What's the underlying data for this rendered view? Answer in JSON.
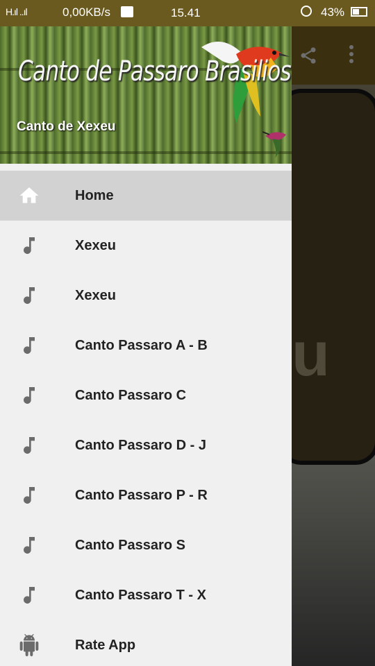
{
  "status_bar": {
    "signal": "H.ıl ..ıl",
    "speed": "0,00KB/s",
    "time": "15.41",
    "battery": "43%"
  },
  "drawer": {
    "app_title": "Canto de Passaro Brasilios",
    "subtitle": "Canto de Xexeu",
    "items": [
      {
        "label": "Home",
        "icon": "home-icon",
        "active": true
      },
      {
        "label": "Xexeu",
        "icon": "music-note-icon"
      },
      {
        "label": "Xexeu",
        "icon": "music-note-icon"
      },
      {
        "label": "Canto Passaro A - B",
        "icon": "music-note-icon"
      },
      {
        "label": "Canto Passaro C",
        "icon": "music-note-icon"
      },
      {
        "label": "Canto Passaro D - J",
        "icon": "music-note-icon"
      },
      {
        "label": "Canto Passaro P - R",
        "icon": "music-note-icon"
      },
      {
        "label": "Canto Passaro S",
        "icon": "music-note-icon"
      },
      {
        "label": "Canto Passaro T - X",
        "icon": "music-note-icon"
      },
      {
        "label": "Rate App",
        "icon": "android-icon"
      }
    ]
  },
  "background": {
    "letter": "u"
  },
  "colors": {
    "status_bar": "#6b5a1f",
    "drawer_bg": "#f0f0f0",
    "active_item": "#d2d2d2",
    "icon_grey": "#6b6b6b"
  }
}
